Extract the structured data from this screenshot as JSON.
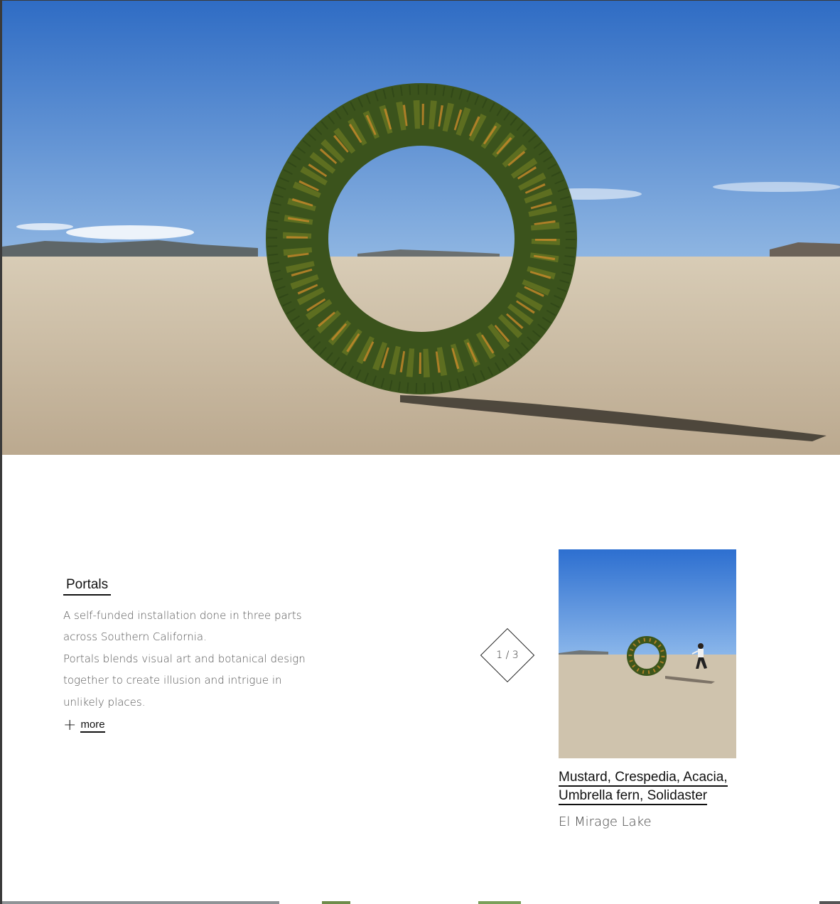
{
  "hero": {
    "icon": "hero-wreath-photo",
    "colors": {
      "sky": "#3f78c8",
      "ground": "#cdbfa9",
      "foliage": "#3f5a1c"
    }
  },
  "project": {
    "title": "Portals",
    "description": [
      "A self-funded installation done in three parts across Southern California.",
      "Portals blends visual art and botanical design together to create illusion and intrigue in unlikely places."
    ],
    "more_label": "more",
    "more_icon": "plus-icon"
  },
  "gallery": {
    "counter": "1 / 3",
    "thumbnail_icon": "wreath-thumbnail-photo",
    "caption": [
      "Mustard, Crespedia, Acacia,",
      "Umbrella fern, Solidaster"
    ],
    "location": "El Mirage Lake"
  }
}
